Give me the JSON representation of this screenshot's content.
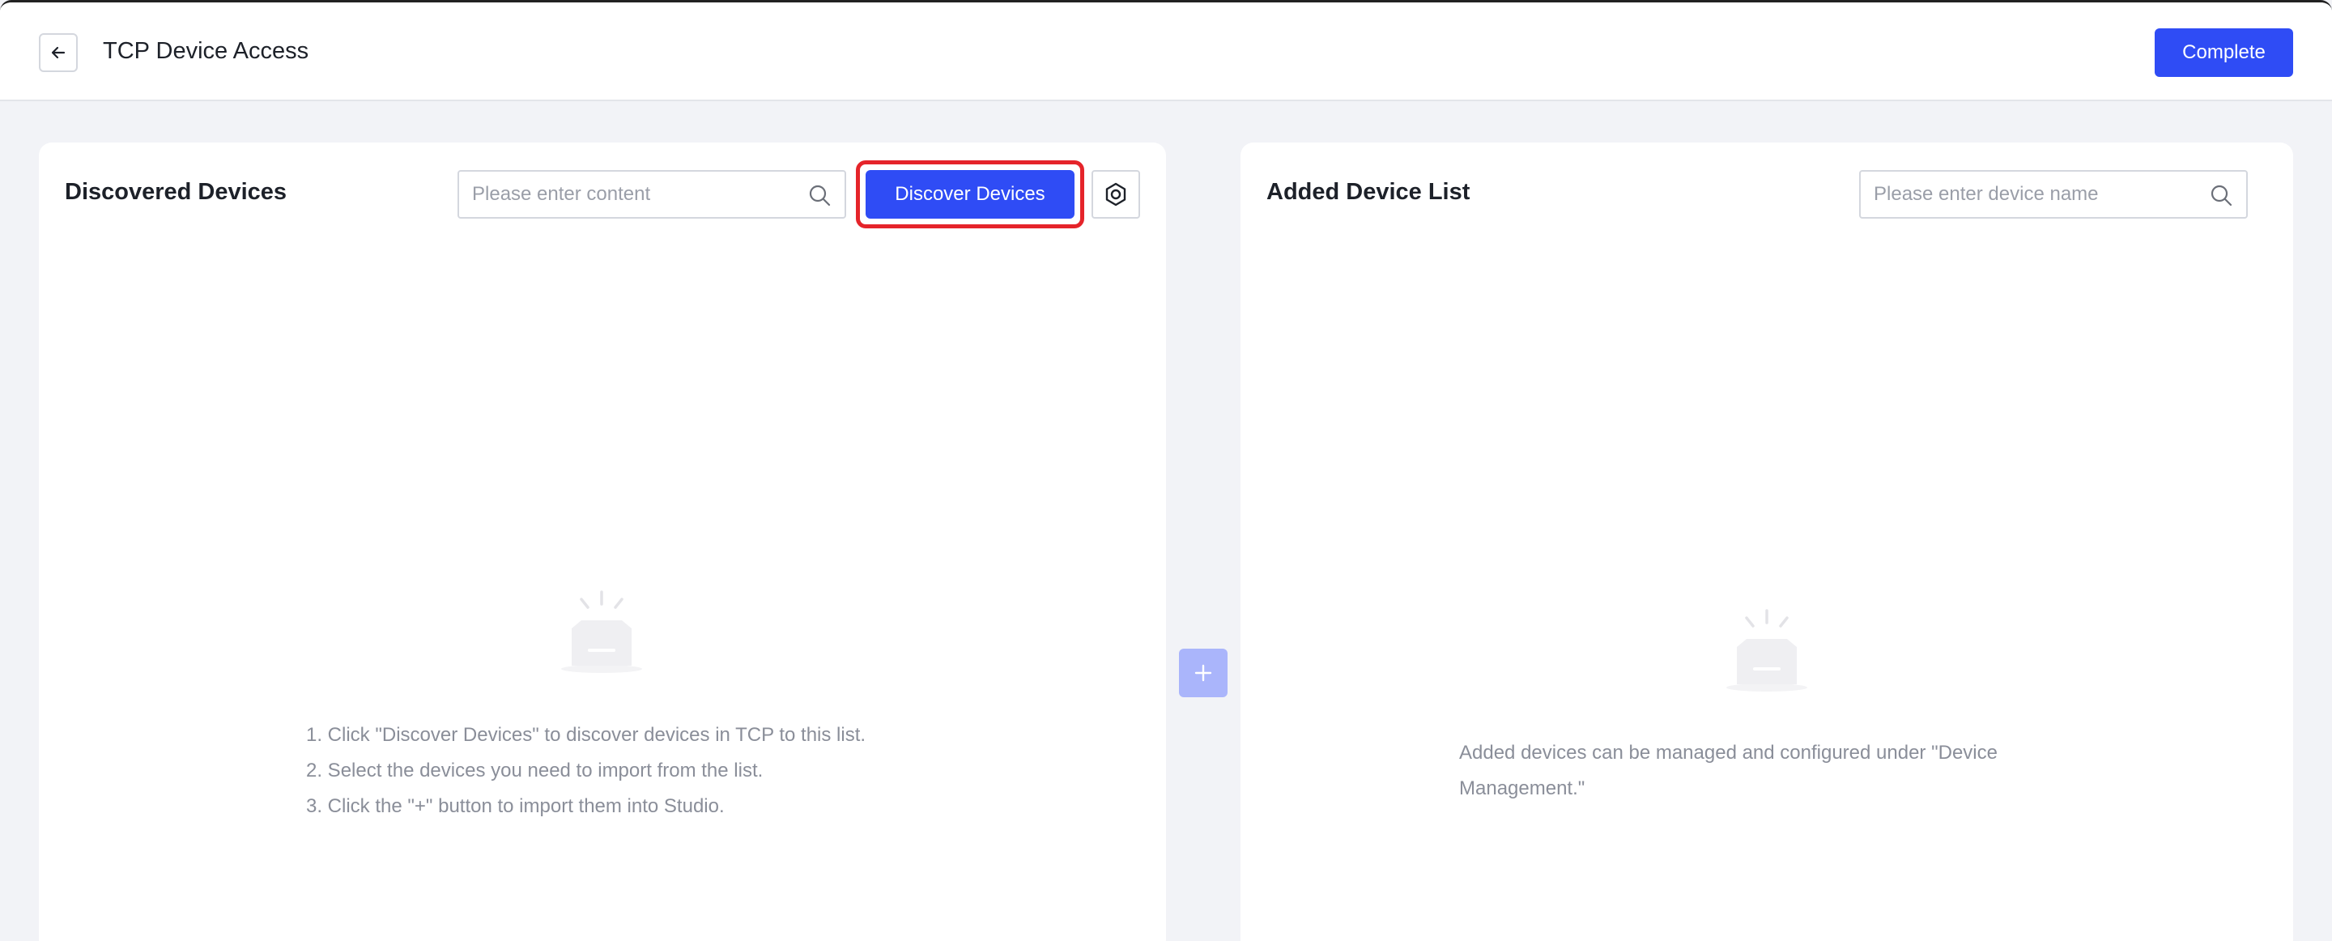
{
  "header": {
    "title": "TCP Device Access",
    "complete_label": "Complete"
  },
  "discovered": {
    "title": "Discovered Devices",
    "search_placeholder": "Please enter content",
    "discover_label": "Discover Devices",
    "hints": [
      "1. Click \"Discover Devices\" to discover devices in TCP to this list.",
      "2. Select the devices you need to import from the list.",
      "3. Click the \"+\" button to import them into Studio."
    ]
  },
  "added": {
    "title": "Added Device List",
    "search_placeholder": "Please enter device name",
    "hint": "Added devices can be managed and configured under \"Device Management.\""
  },
  "colors": {
    "primary": "#2f4cf5",
    "highlight": "#e5242a",
    "add_button_disabled": "#aab5fb"
  },
  "icons": [
    "back-arrow-icon",
    "search-icon",
    "settings-hex-icon",
    "empty-box-icon",
    "plus-icon"
  ]
}
